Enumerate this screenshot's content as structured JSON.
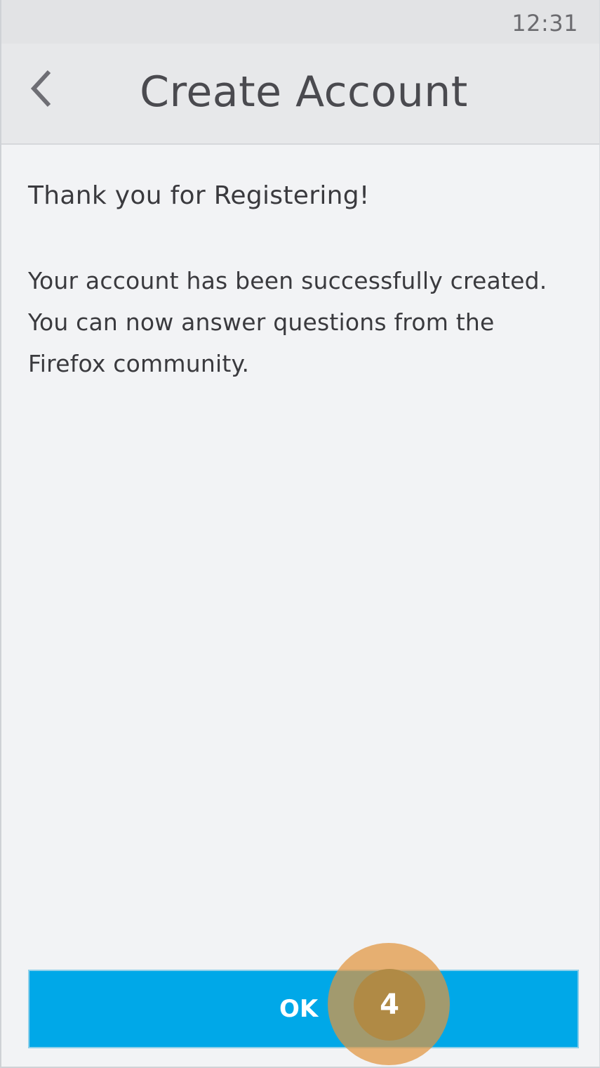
{
  "status_bar": {
    "time": "12:31"
  },
  "header": {
    "back_icon": "chevron-left-icon",
    "title": "Create Account"
  },
  "content": {
    "heading": "Thank you for Registering!",
    "message": "Your account has been successfully created. You can now answer questions from the Firefox community."
  },
  "actions": {
    "ok_label": "OK"
  },
  "touch_marker": {
    "label": "4",
    "color": "#e1943e"
  },
  "colors": {
    "primary_button": "#00a8e8",
    "background": "#f2f3f5",
    "header_background": "#e7e8ea",
    "text": "#3a3a3e"
  }
}
